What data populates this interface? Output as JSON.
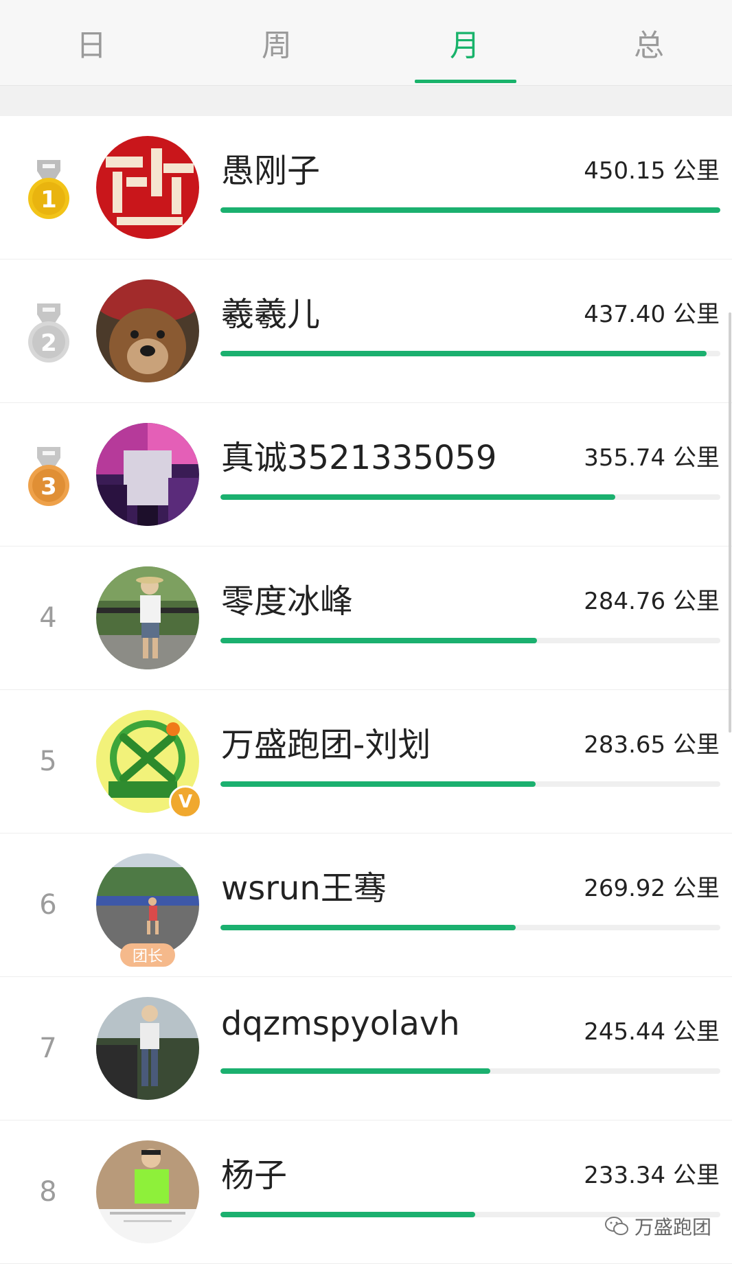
{
  "tabs": [
    {
      "label": "日"
    },
    {
      "label": "周"
    },
    {
      "label": "月",
      "active": true
    },
    {
      "label": "总"
    }
  ],
  "accent_color": "#19b36b",
  "unit": "公里",
  "entries": [
    {
      "rank": "1",
      "medal": "gold",
      "name": "愚刚子",
      "distance": "450.15",
      "unit": "公里",
      "progress": 1.0
    },
    {
      "rank": "2",
      "medal": "silver",
      "name": "羲羲儿",
      "distance": "437.40",
      "unit": "公里",
      "progress": 0.972
    },
    {
      "rank": "3",
      "medal": "bronze",
      "name": "真诚3521335059",
      "distance": "355.74",
      "unit": "公里",
      "progress": 0.79
    },
    {
      "rank": "4",
      "name": "零度冰峰",
      "distance": "284.76",
      "unit": "公里",
      "progress": 0.633
    },
    {
      "rank": "5",
      "name": "万盛跑团-刘划",
      "distance": "283.65",
      "unit": "公里",
      "progress": 0.63,
      "badge": "V"
    },
    {
      "rank": "6",
      "name": "wsrun王骞",
      "distance": "269.92",
      "unit": "公里",
      "progress": 0.59,
      "badge": "团长"
    },
    {
      "rank": "7",
      "name": "dqzmspyolavh",
      "distance": "245.44",
      "unit": "公里",
      "progress": 0.54
    },
    {
      "rank": "8",
      "name": "杨子",
      "distance": "233.34",
      "unit": "公里",
      "progress": 0.51
    }
  ],
  "watermark": "万盛跑团"
}
